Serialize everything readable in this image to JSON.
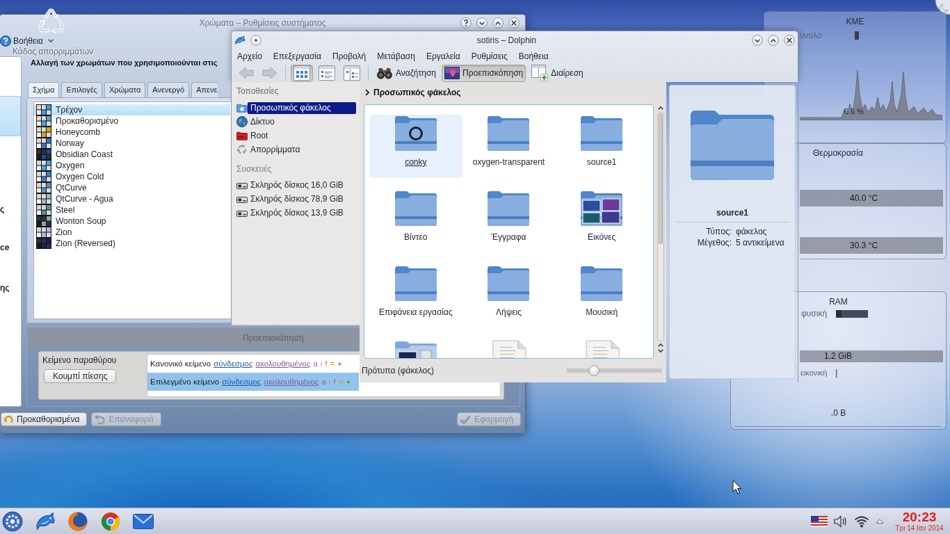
{
  "desktop": {
    "trash_label": "Κάδος απορριμμάτων"
  },
  "colors_window": {
    "title": "Χρώματα – Ρυθμίσεις συστήματος",
    "toolbar_help": "Βοήθεια",
    "sidebar": [
      {
        "selected": true
      },
      {
        "text": "ς",
        "selected": false
      },
      {
        "text": "ce",
        "selected": false
      },
      {
        "text": "ης",
        "selected": false
      }
    ],
    "heading": "Αλλαγή των χρωμάτων που χρησιμοποιούνται στις",
    "tabs": [
      {
        "label": "Σχήμα",
        "selected": true
      },
      {
        "label": "Επιλογές",
        "selected": false
      },
      {
        "label": "Χρώματα",
        "selected": false
      },
      {
        "label": "Ανενεργό",
        "selected": false
      },
      {
        "label": "Απενε",
        "selected": false
      }
    ],
    "schemes": [
      {
        "name": "Τρέχον",
        "selected": true,
        "color": "#3d9ee8",
        "dark": false
      },
      {
        "name": "Προκαθορισμένο",
        "selected": false,
        "color": "#43a6e6",
        "dark": false
      },
      {
        "name": "Honeycomb",
        "selected": false,
        "color": "#e2a400",
        "dark": false
      },
      {
        "name": "Norway",
        "selected": false,
        "color": "#3b78c3",
        "dark": false
      },
      {
        "name": "Obsidian Coast",
        "selected": false,
        "color": "#1e4f86",
        "dark": true
      },
      {
        "name": "Oxygen",
        "selected": false,
        "color": "#43a6e6",
        "dark": false
      },
      {
        "name": "Oxygen Cold",
        "selected": false,
        "color": "#3f7fd8",
        "dark": false
      },
      {
        "name": "QtCurve",
        "selected": false,
        "color": "#5f8fc8",
        "dark": false
      },
      {
        "name": "QtCurve - Agua",
        "selected": false,
        "color": "#9fb6cc",
        "dark": false
      },
      {
        "name": "Steel",
        "selected": false,
        "color": "#4f95a6",
        "dark": false
      },
      {
        "name": "Wonton Soup",
        "selected": false,
        "color": "#8aa1bb",
        "dark": true
      },
      {
        "name": "Zion",
        "selected": false,
        "color": "#aeb6ff",
        "dark": false
      },
      {
        "name": "Zion (Reversed)",
        "selected": false,
        "color": "#0e2467",
        "dark": true
      }
    ],
    "preview": {
      "tab": "Προεπισκόπηση",
      "window_text": "Κείμενο παραθύρου",
      "push_button": "Κουμπί πίεσης",
      "lines": [
        {
          "selected": false,
          "segments": [
            {
              "kind": "normal",
              "text": "Κανονικό κείμενο"
            },
            {
              "kind": "link",
              "text": "σύνδεσμος"
            },
            {
              "kind": "visited",
              "text": "ακολουθημένος"
            },
            {
              "kind": "active",
              "text": "a"
            },
            {
              "kind": "inactive",
              "text": "i"
            },
            {
              "kind": "negative",
              "text": "!"
            },
            {
              "kind": "neutral",
              "text": "="
            },
            {
              "kind": "positive",
              "text": "+"
            }
          ]
        },
        {
          "selected": true,
          "segments": [
            {
              "kind": "normal",
              "text": "Επιλεγμένο κείμενο"
            },
            {
              "kind": "link",
              "text": "σύνδεσμος"
            },
            {
              "kind": "visited",
              "text": "ακολουθημένος"
            },
            {
              "kind": "active",
              "text": "a"
            },
            {
              "kind": "inactive",
              "text": "i"
            },
            {
              "kind": "negative",
              "text": "!"
            },
            {
              "kind": "neutral",
              "text": "="
            },
            {
              "kind": "positive",
              "text": "+"
            }
          ]
        }
      ]
    },
    "buttons": [
      {
        "kind": "defaults",
        "label": "Προκαθορισμένα",
        "disabled": false
      },
      {
        "kind": "reset",
        "label": "Επαναφορά",
        "disabled": true
      },
      {
        "kind": "apply",
        "label": "Εφαρμογή",
        "disabled": true
      }
    ]
  },
  "dolphin": {
    "title": "sotiris – Dolphin",
    "menu": [
      "Αρχείο",
      "Επεξεργασία",
      "Προβολή",
      "Μετάβαση",
      "Εργαλεία",
      "Ρυθμίσεις",
      "Βοήθεια"
    ],
    "toolbar": [
      {
        "kind": "back",
        "disabled": true
      },
      {
        "kind": "forward",
        "disabled": true
      },
      {
        "kind": "icons",
        "checked": true
      },
      {
        "kind": "details",
        "checked": false
      },
      {
        "kind": "columns",
        "checked": false
      },
      {
        "kind": "search",
        "label": "Αναζήτηση",
        "checked": false
      },
      {
        "kind": "preview",
        "label": "Προεπισκόπηση",
        "checked": true
      },
      {
        "kind": "split",
        "label": "Διαίρεση",
        "checked": false
      }
    ],
    "places": {
      "title": "Τοποθεσίες",
      "items": [
        {
          "kind": "home",
          "label": "Προσωπικός φάκελος",
          "selected": true
        },
        {
          "kind": "network",
          "label": "Δίκτυο",
          "selected": false
        },
        {
          "kind": "root",
          "label": "Root",
          "selected": false
        },
        {
          "kind": "trash",
          "label": "Απορρίμματα",
          "selected": false
        }
      ],
      "devices_title": "Συσκευές",
      "devices": [
        {
          "label": "Σκληρός δίσκος 16,0 GiB",
          "selected": false
        },
        {
          "label": "Σκληρός δίσκος 78,9 GiB",
          "selected": false
        },
        {
          "label": "Σκληρός δίσκος 13,9 GiB",
          "selected": false
        }
      ]
    },
    "breadcrumb": "Προσωπικός φάκελος",
    "files": [
      {
        "kind": "folder-emblem",
        "label": "conky",
        "hovered": true
      },
      {
        "kind": "folder",
        "label": "oxygen-transparent",
        "hovered": false
      },
      {
        "kind": "folder",
        "label": "source1",
        "hovered": false
      },
      {
        "kind": "folder",
        "label": "Βίντεο",
        "hovered": false
      },
      {
        "kind": "folder",
        "label": "Έγγραφα",
        "hovered": false
      },
      {
        "kind": "folder-pictures",
        "label": "Εικόνες",
        "hovered": false
      },
      {
        "kind": "folder",
        "label": "Επιφάνεια εργασίας",
        "hovered": false
      },
      {
        "kind": "folder",
        "label": "Λήψεις",
        "hovered": false
      },
      {
        "kind": "folder",
        "label": "Μουσική",
        "hovered": false
      },
      {
        "kind": "folder-photos",
        "hovered": false
      },
      {
        "kind": "document",
        "hovered": false
      },
      {
        "kind": "document",
        "hovered": false
      }
    ],
    "status": "Πρότυπα (φάκελος)",
    "zoom": {
      "level": 0.26
    },
    "info": {
      "name": "source1",
      "rows": [
        {
          "key": "Τύπος:",
          "value": "φάκελος"
        },
        {
          "key": "Μέγεθος:",
          "value": "5 αντικείμενα"
        }
      ]
    }
  },
  "widgets": {
    "cpu": {
      "title": "ΚΜΕ",
      "total_label": "ύνολο",
      "load": "6.5 %"
    },
    "temperature": {
      "title": "Θερμοκρασία",
      "readings": [
        "40.0 °C",
        "30.3 °C"
      ]
    },
    "ram": {
      "title": "RAM",
      "physical_label": "φυσική",
      "physical": "1.2 GiB",
      "virtual_label": "εικονική",
      "virtual": ".0 B"
    }
  },
  "taskbar": {
    "time": "20:23",
    "date": "Τρι 14 Ιαν 2014"
  }
}
